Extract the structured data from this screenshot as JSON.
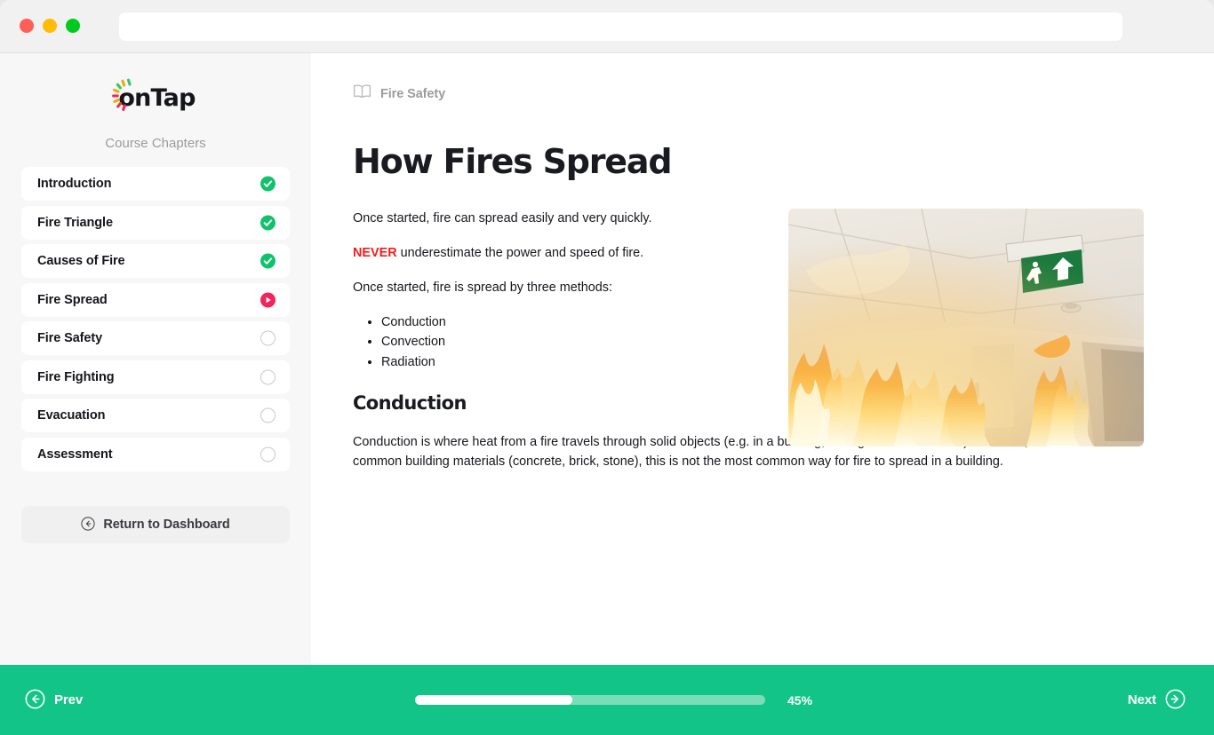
{
  "browser": {
    "traffic_lights": [
      "close",
      "minimize",
      "zoom"
    ],
    "url_value": "",
    "url_placeholder": ""
  },
  "sidebar": {
    "logo_text": "onTap",
    "logo_burst_colors": [
      "#f6a700",
      "#2fc66a",
      "#f2245f",
      "#f6a700",
      "#2fc66a",
      "#f2245f",
      "#f6a700",
      "#e03a3a"
    ],
    "section_label": "Course Chapters",
    "chapters": [
      {
        "label": "Introduction",
        "status": "done"
      },
      {
        "label": "Fire Triangle",
        "status": "done"
      },
      {
        "label": "Causes of Fire",
        "status": "done"
      },
      {
        "label": "Fire Spread",
        "status": "active"
      },
      {
        "label": "Fire Safety",
        "status": "pending"
      },
      {
        "label": "Fire Fighting",
        "status": "pending"
      },
      {
        "label": "Evacuation",
        "status": "pending"
      },
      {
        "label": "Assessment",
        "status": "pending"
      }
    ],
    "return_button": {
      "label": "Return to Dashboard",
      "icon": "arrow-left-circle-icon"
    }
  },
  "main": {
    "breadcrumb": {
      "icon": "book-icon",
      "label": "Fire Safety"
    },
    "title": "How Fires Spread",
    "paragraph_1": "Once started, fire can spread easily and very quickly.",
    "paragraph_2_emphasis": "NEVER",
    "paragraph_2_rest": " underestimate the power and speed of fire.",
    "paragraph_3": "Once started, fire is spread by three methods:",
    "methods": [
      "Conduction",
      "Convection",
      "Radiation"
    ],
    "subheading": "Conduction",
    "conduction_text": "Conduction is where heat from a fire travels through solid objects (e.g. in a building, through walls and floors). However, due to the nature of common building materials (concrete, brick, stone), this is not the most common way for fire to spread in a building.",
    "image": {
      "name": "fire-corridor-photo",
      "alt": "Flames spreading along a corridor ceiling beneath a green emergency exit sign",
      "exit_sign_color": "#1c7a3e"
    }
  },
  "footer": {
    "prev_label": "Prev",
    "prev_icon": "arrow-left-circle-icon",
    "next_label": "Next",
    "next_icon": "arrow-right-circle-icon",
    "progress_percent_label": "45%",
    "progress_percent_value": 45,
    "bar_color": "#ffffff",
    "track_color": "#7adcb9",
    "footer_color": "#13c489"
  }
}
